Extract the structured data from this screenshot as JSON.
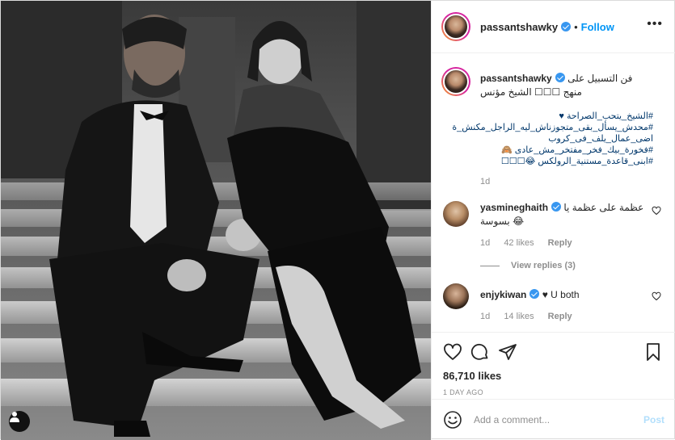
{
  "post": {
    "author": "passantshawky",
    "follow_label": "Follow",
    "separator": "•",
    "more_icon": "•••"
  },
  "caption": {
    "username": "passantshawky",
    "text": "فن التسبيل على منهج ☐☐☐ الشيخ مؤنس",
    "hashtags": [
      "#الشيخ_يتحب_الصراحة ♥",
      "#محدش_يسأل_بقى_متجوزناش_ليه_الراجل_مكنش_ة اضى_عمال_يلف_فى_كروب",
      "#فخورة_بيك_فخر_مفتخر_مش_عادى 🙈",
      "#ابنى_قاعدة_مستنية_الرولكس 😂☐☐☐"
    ],
    "time": "1d"
  },
  "comments": [
    {
      "username": "yasmineghaith",
      "text": "عظمة على عظمة يا بسوسة 😂",
      "time": "1d",
      "likes": "42 likes",
      "reply_label": "Reply",
      "view_replies": "View replies (3)"
    },
    {
      "username": "enjykiwan",
      "text": "♥ U both",
      "time": "1d",
      "likes": "14 likes",
      "reply_label": "Reply"
    }
  ],
  "actions": {
    "likes": "86,710 likes",
    "timestamp": "1 DAY AGO"
  },
  "add_comment": {
    "placeholder": "Add a comment...",
    "post_label": "Post"
  },
  "icons": {
    "like": "heart-icon",
    "comment": "comment-bubble-icon",
    "share": "paper-plane-icon",
    "save": "bookmark-icon",
    "emoji": "emoji-icon",
    "user_tag": "person-icon"
  },
  "colors": {
    "accent": "#0095f6",
    "link": "#00376b",
    "muted": "#8e8e8e",
    "verified": "#3897f0",
    "post_disabled": "#b2dffc"
  }
}
